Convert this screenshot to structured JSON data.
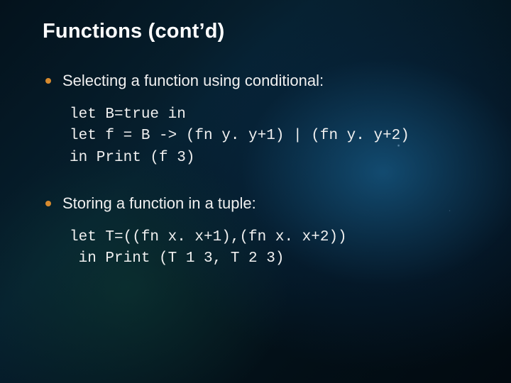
{
  "title": "Functions (cont’d)",
  "bullets": [
    {
      "text": "Selecting a function using conditional:"
    },
    {
      "text": "Storing a function in a tuple:"
    }
  ],
  "code_blocks": [
    "let B=true in\nlet f = B -> (fn y. y+1) | (fn y. y+2)\nin Print (f 3)",
    "let T=((fn x. x+1),(fn x. x+2))\n in Print (T 1 3, T 2 3)"
  ],
  "accent_color": "#d78a2e"
}
